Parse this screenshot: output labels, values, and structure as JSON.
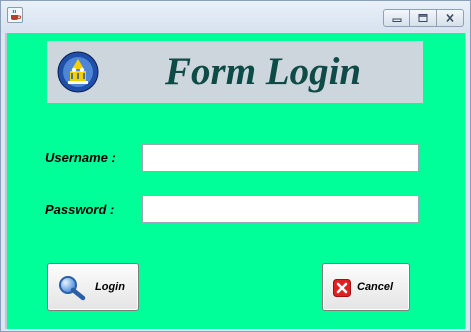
{
  "window": {
    "icon": "java-cup-icon",
    "controls": [
      "minimize-icon",
      "maximize-icon",
      "close-icon"
    ]
  },
  "banner": {
    "title": "Form Login",
    "logo": "tut-wuri-handayani-emblem"
  },
  "form": {
    "username_label": "Username :",
    "username_value": "",
    "password_label": "Password :",
    "password_value": ""
  },
  "buttons": {
    "login_label": "Login",
    "login_icon": "magnifier-icon",
    "cancel_label": "Cancel",
    "cancel_icon": "red-x-icon"
  },
  "colors": {
    "background": "#00ff99",
    "banner_bg": "#cdd6dc",
    "title_color": "#0e4a46"
  }
}
